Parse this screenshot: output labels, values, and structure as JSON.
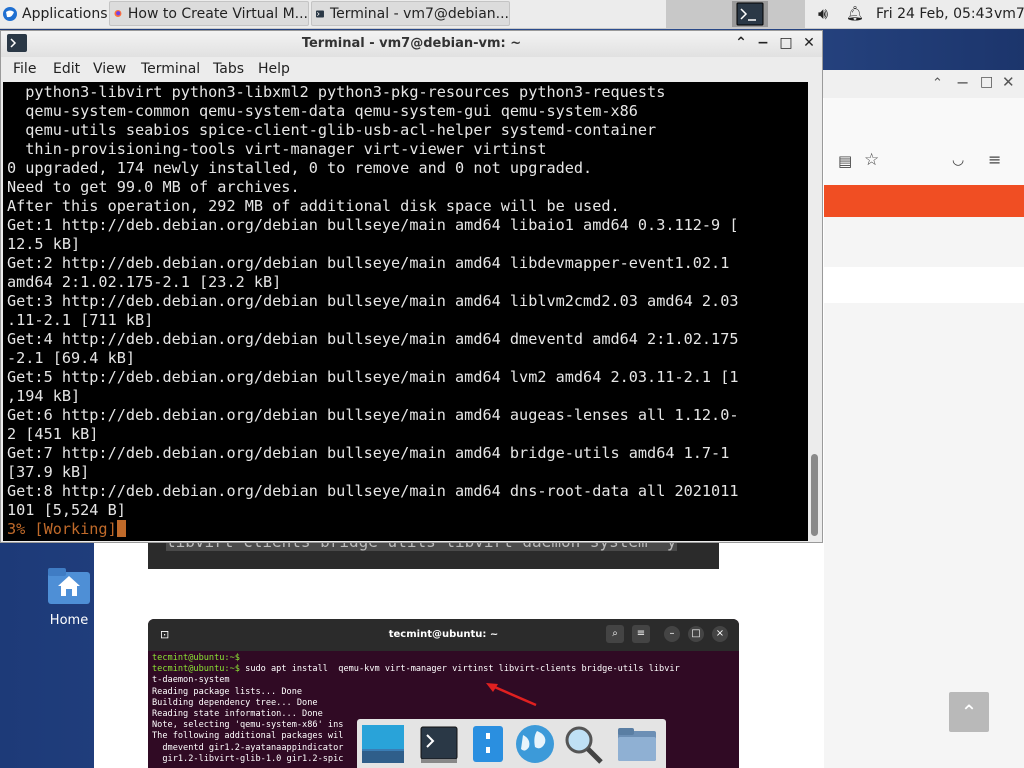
{
  "panel": {
    "applications_label": "Applications",
    "tasks": [
      {
        "label": "How to Create Virtual M...",
        "icon": "firefox-icon"
      },
      {
        "label": "Terminal - vm7@debian...",
        "icon": "terminal-icon"
      }
    ],
    "clock": "Fri 24 Feb, 05:43",
    "user": "vm7"
  },
  "desktop": {
    "home_label": "Home"
  },
  "terminal": {
    "title": "Terminal - vm7@debian-vm: ~",
    "menu": [
      "File",
      "Edit",
      "View",
      "Terminal",
      "Tabs",
      "Help"
    ],
    "lines": [
      "  python3-libvirt python3-libxml2 python3-pkg-resources python3-requests",
      "  qemu-system-common qemu-system-data qemu-system-gui qemu-system-x86",
      "  qemu-utils seabios spice-client-glib-usb-acl-helper systemd-container",
      "  thin-provisioning-tools virt-manager virt-viewer virtinst",
      "0 upgraded, 174 newly installed, 0 to remove and 0 not upgraded.",
      "Need to get 99.0 MB of archives.",
      "After this operation, 292 MB of additional disk space will be used.",
      "Get:1 http://deb.debian.org/debian bullseye/main amd64 libaio1 amd64 0.3.112-9 [",
      "12.5 kB]",
      "Get:2 http://deb.debian.org/debian bullseye/main amd64 libdevmapper-event1.02.1",
      "amd64 2:1.02.175-2.1 [23.2 kB]",
      "Get:3 http://deb.debian.org/debian bullseye/main amd64 liblvm2cmd2.03 amd64 2.03",
      ".11-2.1 [711 kB]",
      "Get:4 http://deb.debian.org/debian bullseye/main amd64 dmeventd amd64 2:1.02.175",
      "-2.1 [69.4 kB]",
      "Get:5 http://deb.debian.org/debian bullseye/main amd64 lvm2 amd64 2.03.11-2.1 [1",
      ",194 kB]",
      "Get:6 http://deb.debian.org/debian bullseye/main amd64 augeas-lenses all 1.12.0-",
      "2 [451 kB]",
      "Get:7 http://deb.debian.org/debian bullseye/main amd64 bridge-utils amd64 1.7-1",
      "[37.9 kB]",
      "Get:8 http://deb.debian.org/debian bullseye/main amd64 dns-root-data all 2021011",
      "101 [5,524 B]"
    ],
    "progress_line": "3% [Working]"
  },
  "browser": {
    "code_snippet": "libvirt-clients bridge-utils libvirt-daemon-system -y",
    "embedded_terminal": {
      "title": "tecmint@ubuntu: ~",
      "prompt": "tecmint@ubuntu:~$",
      "command": " sudo apt install  qemu-kvm virt-manager virtinst libvirt-clients bridge-utils libvir",
      "lines": [
        "t-daemon-system",
        "Reading package lists... Done",
        "Building dependency tree... Done",
        "Reading state information... Done",
        "Note, selecting 'qemu-system-x86' ins",
        "The following additional packages wil",
        "  dmeventd gir1.2-ayatanaappindicator",
        "  gir1.2-libvirt-glib-1.0 gir1.2-spic"
      ]
    }
  },
  "colors": {
    "terminal_bg": "#000000",
    "terminal_fg": "#e6e6e6",
    "progress_color": "#c06a2a",
    "accent_orange": "#f04e23"
  }
}
